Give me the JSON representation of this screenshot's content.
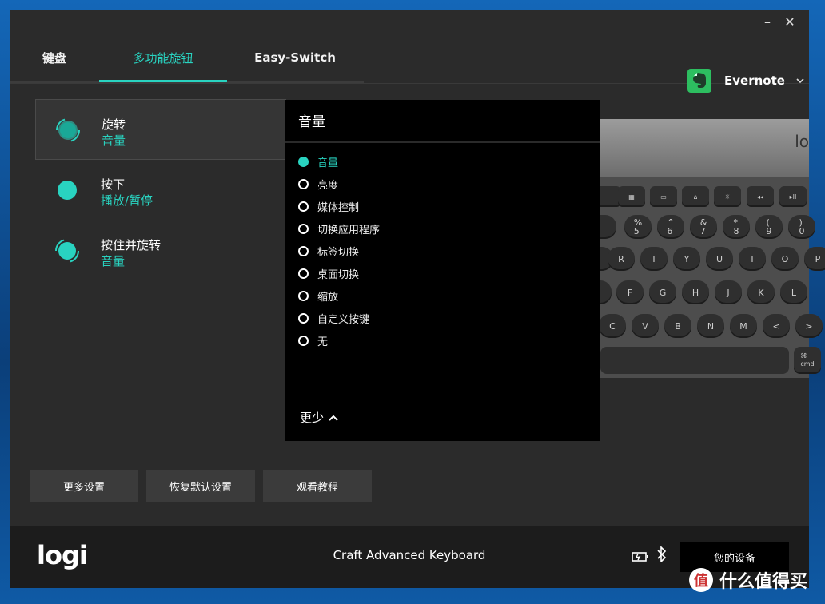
{
  "window": {
    "minimize_glyph": "–",
    "close_glyph": "✕"
  },
  "tabs": [
    {
      "label": "键盘"
    },
    {
      "label": "多功能旋钮"
    },
    {
      "label": "Easy-Switch"
    }
  ],
  "app_selector": {
    "label": "Evernote",
    "icon": "evernote-icon"
  },
  "actions": [
    {
      "title": "旋转",
      "value": "音量",
      "icon": "rotate-dial-icon",
      "selected": true
    },
    {
      "title": "按下",
      "value": "播放/暂停",
      "icon": "press-dial-icon",
      "selected": false
    },
    {
      "title": "按住并旋转",
      "value": "音量",
      "icon": "press-rotate-dial-icon",
      "selected": false
    }
  ],
  "dropdown": {
    "title": "音量",
    "options": [
      "音量",
      "亮度",
      "媒体控制",
      "切换应用程序",
      "标签切换",
      "桌面切换",
      "缩放",
      "自定义按键",
      "无"
    ],
    "selected_index": 0,
    "more_label": "更少"
  },
  "keyboard_preview": {
    "logo_text": "lo",
    "fn_row": [
      "▦",
      "▭",
      "⌂",
      "☼",
      "◂◂",
      "▸II",
      "▸"
    ],
    "num_row": [
      "%\n5",
      "^\n6",
      "&\n7",
      "*\n8",
      "(\n9",
      ")\n0"
    ],
    "row1": [
      "R",
      "T",
      "Y",
      "U",
      "I",
      "O",
      "P"
    ],
    "row2": [
      "F",
      "G",
      "H",
      "J",
      "K",
      "L"
    ],
    "row3": [
      "C",
      "V",
      "B",
      "N",
      "M",
      "<",
      ">"
    ],
    "cmd_label": "⌘\ncmd"
  },
  "bottom_buttons": [
    "更多设置",
    "恢复默认设置",
    "观看教程"
  ],
  "footer": {
    "brand": "logi",
    "device_name": "Craft Advanced Keyboard",
    "your_devices": "您的设备"
  },
  "watermark": {
    "logo": "值",
    "text": "什么值得买"
  },
  "colors": {
    "accent": "#29d3c0",
    "background": "#2b2b2b",
    "footer": "#1c1c1c"
  }
}
